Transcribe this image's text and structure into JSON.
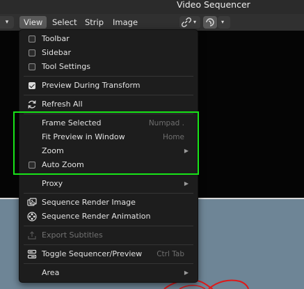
{
  "window": {
    "title": "Video Sequencer"
  },
  "header": {
    "menus": [
      "View",
      "Select",
      "Strip",
      "Image"
    ]
  },
  "view_menu": {
    "items": [
      {
        "label": "Toolbar",
        "underline": "T",
        "type": "checkbox",
        "checked": false
      },
      {
        "label": "Sidebar",
        "underline": "S",
        "type": "checkbox",
        "checked": false
      },
      {
        "label": "Tool Settings",
        "type": "checkbox",
        "checked": false
      },
      {
        "label": "Preview During Transform",
        "type": "checkbox",
        "checked": true
      },
      {
        "label": "Refresh All",
        "icon": "refresh-icon"
      },
      {
        "label": "Frame Selected",
        "shortcut": "Numpad ."
      },
      {
        "label": "Fit Preview in Window",
        "shortcut": "Home"
      },
      {
        "label": "Zoom",
        "submenu": true
      },
      {
        "label": "Auto Zoom",
        "type": "checkbox",
        "checked": false
      },
      {
        "label": "Proxy",
        "submenu": true
      },
      {
        "label": "Sequence Render Image",
        "icon": "render-image-icon"
      },
      {
        "label": "Sequence Render Animation",
        "icon": "render-animation-icon"
      },
      {
        "label": "Export Subtitles",
        "icon": "export-icon",
        "disabled": true
      },
      {
        "label": "Toggle Sequencer/Preview",
        "icon": "toggle-view-icon",
        "shortcut": "Ctrl Tab"
      },
      {
        "label": "Area",
        "submenu": true
      }
    ]
  },
  "colors": {
    "menu_bg": "#1d1d1d",
    "highlight_outline": "#18e418",
    "preview_bg": "#6e8596",
    "annotation_red": "#e01818"
  }
}
